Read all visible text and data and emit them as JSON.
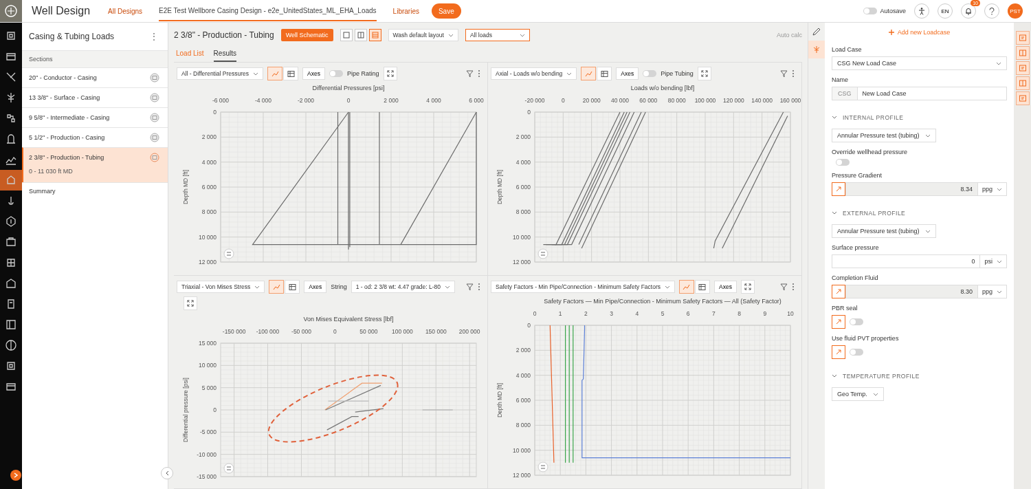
{
  "topbar": {
    "app_title": "Well Design",
    "nav": [
      {
        "label": "All Designs",
        "kind": "link"
      },
      {
        "label": "E2E Test Wellbore Casing Design - e2e_UnitedStates_ML_EHA_Loads",
        "kind": "current"
      },
      {
        "label": "Libraries",
        "kind": "link"
      }
    ],
    "save": "Save",
    "autosave": {
      "label": "Autosave",
      "on": false
    },
    "lang": "EN",
    "notifications": "10",
    "avatar": "PST"
  },
  "rail": [
    {
      "selected": false
    },
    {
      "selected": false
    },
    {
      "selected": false
    },
    {
      "selected": false
    },
    {
      "selected": false
    },
    {
      "selected": false
    },
    {
      "selected": false
    },
    {
      "selected": true
    },
    {
      "selected": false
    },
    {
      "selected": false
    },
    {
      "selected": false
    },
    {
      "selected": false
    },
    {
      "selected": false
    },
    {
      "selected": false
    },
    {
      "selected": false
    },
    {
      "selected": false
    },
    {
      "selected": false
    },
    {
      "selected": false
    }
  ],
  "sidebar": {
    "title": "Casing & Tubing Loads",
    "menu": "⋮",
    "group": "Sections",
    "items": [
      {
        "label": "20\" - Conductor - Casing",
        "kind": "string",
        "selected": false
      },
      {
        "label": "13 3/8\" - Surface - Casing",
        "kind": "string",
        "selected": false
      },
      {
        "label": "9 5/8\" - Intermediate - Casing",
        "kind": "string",
        "selected": false
      },
      {
        "label": "5 1/2\" - Production - Casing",
        "kind": "string",
        "selected": false
      },
      {
        "label": "2 3/8\" - Production - Tubing",
        "detail": "0 - 11 030 ft MD",
        "kind": "string",
        "selected": true
      },
      {
        "label": "Summary",
        "kind": "summary",
        "selected": false
      }
    ]
  },
  "header": {
    "title": "2 3/8\" - Production - Tubing",
    "schematic": "Well Schematic",
    "layouts": [
      {
        "selected": false
      },
      {
        "selected": false
      },
      {
        "selected": true
      }
    ],
    "layout_select": "Wash default layout",
    "loads_select": "All loads",
    "auto_calc": "Auto calc"
  },
  "tabs": [
    {
      "label": "Load List",
      "selected": false
    },
    {
      "label": "Results",
      "selected": true
    }
  ],
  "panels": [
    {
      "toolbar": {
        "selector": "All - Differential Pressures",
        "views": [
          {
            "selected": true
          },
          {
            "selected": false
          }
        ],
        "axes": "Axes",
        "toggle": {
          "label": "Pipe Rating",
          "on": false
        }
      },
      "highlight": false,
      "chart_data": {
        "type": "line",
        "grid": true,
        "xlabel": "Differential Pressures [psi]",
        "ylabel": "Depth MD [ft]",
        "x": [
          0,
          -4500,
          6000,
          6000,
          6000,
          2450,
          -500,
          -500,
          0,
          0,
          60,
          60,
          1450,
          1450
        ],
        "xlim": [
          -6000,
          6000
        ],
        "ylim": [
          12000,
          0
        ],
        "xticks": [
          {
            "value": -6000,
            "label": "-6 000"
          },
          {
            "value": -4000,
            "label": "-4 000"
          },
          {
            "value": -2000,
            "label": "-2 000"
          },
          {
            "value": 0,
            "label": "0"
          },
          {
            "value": 2000,
            "label": "2 000"
          },
          {
            "value": 4000,
            "label": "4 000"
          },
          {
            "value": 6000,
            "label": "6 000"
          }
        ],
        "yticks": [
          {
            "value": 0,
            "label": "0"
          },
          {
            "value": 2000,
            "label": "2 000"
          },
          {
            "value": 4000,
            "label": "4 000"
          },
          {
            "value": 6000,
            "label": "6 000"
          },
          {
            "value": 8000,
            "label": "8 000"
          },
          {
            "value": 10000,
            "label": "10 000"
          },
          {
            "value": 12000,
            "label": "12 000"
          }
        ],
        "series": [
          {
            "color": "#6b6b6b",
            "values": [
              0,
              10600,
              10600,
              0,
              null,
              null,
              null,
              null,
              null,
              null,
              null,
              null,
              null,
              null
            ]
          },
          {
            "color": "#6b6b6b",
            "values": [
              null,
              null,
              null,
              null,
              0,
              10600,
              null,
              null,
              null,
              null,
              null,
              null,
              null,
              null
            ]
          },
          {
            "color": "#6b6b6b",
            "values": [
              null,
              null,
              null,
              null,
              null,
              null,
              0,
              10600,
              null,
              null,
              null,
              null,
              null,
              null
            ]
          },
          {
            "color": "#6b6b6b",
            "values": [
              null,
              null,
              null,
              null,
              null,
              null,
              null,
              null,
              0,
              11000,
              null,
              null,
              null,
              null
            ]
          },
          {
            "color": "#6b6b6b",
            "values": [
              null,
              null,
              null,
              null,
              null,
              null,
              null,
              null,
              null,
              null,
              0,
              10800,
              null,
              null
            ]
          },
          {
            "color": "#6b6b6b",
            "values": [
              null,
              null,
              null,
              null,
              null,
              null,
              null,
              null,
              null,
              null,
              null,
              null,
              0,
              10600
            ]
          }
        ]
      }
    },
    {
      "toolbar": {
        "selector": "Axial - Loads w/o bending",
        "views": [
          {
            "selected": true
          },
          {
            "selected": false
          }
        ],
        "axes": "Axes",
        "toggle": {
          "label": "Pipe Tubing",
          "on": false
        }
      },
      "highlight": false,
      "chart_data": {
        "type": "line",
        "grid": true,
        "xlabel": "Loads w/o bending [lbf]",
        "ylabel": "Depth MD [ft]",
        "x": [
          40000,
          -5000,
          -14000,
          43000,
          -1000,
          -8000,
          45000,
          1000,
          47000,
          3000,
          -6000,
          50000,
          6000,
          -12000,
          55000,
          11000,
          58000,
          13000,
          155000,
          107000,
          106000,
          158000,
          112000
        ],
        "xlim": [
          -20000,
          160000
        ],
        "ylim": [
          12000,
          0
        ],
        "xticks": [
          {
            "value": -20000,
            "label": "-20 000"
          },
          {
            "value": 0,
            "label": "0"
          },
          {
            "value": 20000,
            "label": "20 000"
          },
          {
            "value": 40000,
            "label": "40 000"
          },
          {
            "value": 60000,
            "label": "60 000"
          },
          {
            "value": 80000,
            "label": "80 000"
          },
          {
            "value": 100000,
            "label": "100 000"
          },
          {
            "value": 120000,
            "label": "120 000"
          },
          {
            "value": 140000,
            "label": "140 000"
          },
          {
            "value": 160000,
            "label": "160 000"
          }
        ],
        "yticks": [
          {
            "value": 0,
            "label": "0"
          },
          {
            "value": 2000,
            "label": "2 000"
          },
          {
            "value": 4000,
            "label": "4 000"
          },
          {
            "value": 6000,
            "label": "6 000"
          },
          {
            "value": 8000,
            "label": "8 000"
          },
          {
            "value": 10000,
            "label": "10 000"
          },
          {
            "value": 12000,
            "label": "12 000"
          }
        ],
        "series": [
          {
            "color": "#6b6b6b",
            "values": [
              0,
              10600,
              10600,
              null,
              null,
              null,
              null,
              null,
              null,
              null,
              null,
              null,
              null,
              null,
              null,
              null,
              null,
              null,
              null,
              null,
              null,
              null,
              null
            ]
          },
          {
            "color": "#6b6b6b",
            "values": [
              null,
              null,
              null,
              0,
              10600,
              10600,
              null,
              null,
              null,
              null,
              null,
              null,
              null,
              null,
              null,
              null,
              null,
              null,
              null,
              null,
              null,
              null,
              null
            ]
          },
          {
            "color": "#6b6b6b",
            "values": [
              null,
              null,
              null,
              null,
              null,
              null,
              0,
              10600,
              null,
              null,
              null,
              null,
              null,
              null,
              null,
              null,
              null,
              null,
              null,
              null,
              null,
              null,
              null
            ]
          },
          {
            "color": "#6b6b6b",
            "values": [
              null,
              null,
              null,
              null,
              null,
              null,
              null,
              null,
              0,
              10600,
              10600,
              null,
              null,
              null,
              null,
              null,
              null,
              null,
              null,
              null,
              null,
              null,
              null
            ]
          },
          {
            "color": "#6b6b6b",
            "values": [
              null,
              null,
              null,
              null,
              null,
              null,
              null,
              null,
              null,
              null,
              null,
              0,
              10600,
              10600,
              null,
              null,
              null,
              null,
              null,
              null,
              null,
              null,
              null
            ]
          },
          {
            "color": "#6b6b6b",
            "values": [
              null,
              null,
              null,
              null,
              null,
              null,
              null,
              null,
              null,
              null,
              null,
              null,
              null,
              null,
              0,
              10600,
              null,
              null,
              null,
              null,
              null,
              null,
              null
            ]
          },
          {
            "color": "#6b6b6b",
            "values": [
              null,
              null,
              null,
              null,
              null,
              null,
              null,
              null,
              null,
              null,
              null,
              null,
              null,
              null,
              null,
              null,
              0,
              10900,
              null,
              null,
              null,
              null,
              null
            ]
          },
          {
            "color": "#6b6b6b",
            "values": [
              null,
              null,
              null,
              null,
              null,
              null,
              null,
              null,
              null,
              null,
              null,
              null,
              null,
              null,
              null,
              null,
              null,
              null,
              0,
              10300,
              10900,
              null,
              null
            ]
          },
          {
            "color": "#6b6b6b",
            "values": [
              null,
              null,
              null,
              null,
              null,
              null,
              null,
              null,
              null,
              null,
              null,
              null,
              null,
              null,
              null,
              null,
              null,
              null,
              null,
              null,
              null,
              300,
              10900
            ]
          }
        ]
      }
    },
    {
      "toolbar": {
        "selector": "Triaxial - Von Mises Stress",
        "views": [
          {
            "selected": true
          },
          {
            "selected": false
          }
        ],
        "axes": "Axes",
        "string": {
          "label": "String",
          "value": "1 - od: 2 3/8 wt: 4.47 grade: L-80"
        }
      },
      "highlight": true,
      "chart_data": {
        "type": "line",
        "grid": true,
        "xlabel": "Von Mises Equivalent Stress [lbf]",
        "ylabel": "Differential pressure [psi]",
        "x": [
          -15000,
          40000,
          70000,
          -14000,
          68000,
          30000,
          72000,
          -12000,
          25000,
          35000,
          -10000,
          50000,
          130000,
          175000
        ],
        "xlim": [
          -170000,
          210000
        ],
        "ylim": [
          -15000,
          15000
        ],
        "xticks": [
          {
            "value": -150000,
            "label": "-150 000"
          },
          {
            "value": -100000,
            "label": "-100 000"
          },
          {
            "value": -50000,
            "label": "-50 000"
          },
          {
            "value": 0,
            "label": "0"
          },
          {
            "value": 50000,
            "label": "50 000"
          },
          {
            "value": 100000,
            "label": "100 000"
          },
          {
            "value": 150000,
            "label": "150 000"
          },
          {
            "value": 200000,
            "label": "200 000"
          }
        ],
        "yticks": [
          {
            "value": 15000,
            "label": "15 000"
          },
          {
            "value": 10000,
            "label": "10 000"
          },
          {
            "value": 5000,
            "label": "5 000"
          },
          {
            "value": 0,
            "label": "0"
          },
          {
            "value": -5000,
            "label": "-5 000"
          },
          {
            "value": -10000,
            "label": "-10 000"
          },
          {
            "value": -15000,
            "label": "-15 000"
          }
        ],
        "series": [
          {
            "color": "#f0a070",
            "values": [
              0,
              6000,
              6000,
              null,
              null,
              null,
              null,
              null,
              null,
              null,
              null,
              null,
              null,
              null
            ]
          },
          {
            "color": "#777777",
            "values": [
              null,
              null,
              null,
              0,
              5500,
              null,
              null,
              null,
              null,
              null,
              null,
              null,
              null,
              null
            ]
          },
          {
            "color": "#777777",
            "values": [
              null,
              null,
              null,
              null,
              null,
              -500,
              300,
              null,
              null,
              null,
              null,
              null,
              null,
              null
            ]
          },
          {
            "color": "#777777",
            "values": [
              null,
              null,
              null,
              null,
              null,
              null,
              null,
              -4500,
              -1500,
              -1500,
              null,
              null,
              null,
              null
            ]
          },
          {
            "color": "#bbbbbb",
            "values": [
              null,
              null,
              null,
              null,
              null,
              null,
              null,
              null,
              null,
              null,
              2000,
              2000,
              null,
              null
            ]
          },
          {
            "color": "#aaaaaa",
            "values": [
              null,
              null,
              null,
              null,
              null,
              null,
              null,
              null,
              null,
              null,
              null,
              null,
              0,
              0
            ]
          }
        ]
      }
    },
    {
      "toolbar": {
        "selector": "Safety Factors - Min Pipe/Connection - Minimum Safety Factors",
        "views": [
          {
            "selected": true
          },
          {
            "selected": false
          }
        ],
        "axes": "Axes"
      },
      "highlight": false,
      "chart_data": {
        "type": "line",
        "grid": true,
        "xlabel": "Safety Factors — Min Pipe/Connection - Minimum Safety Factors — All (Safety Factor)",
        "ylabel": "Depth MD [ft]",
        "x": [
          0.6,
          0.75,
          1.2,
          1.2,
          1.35,
          1.35,
          1.5,
          1.5,
          1.95,
          1.95,
          1.9,
          1.85,
          1.85,
          10
        ],
        "xlim": [
          0,
          10
        ],
        "ylim": [
          12000,
          0
        ],
        "xticks": [
          0,
          1,
          2,
          3,
          4,
          5,
          6,
          7,
          8,
          9,
          10
        ],
        "yticks": [
          {
            "value": 0,
            "label": "0"
          },
          {
            "value": 2000,
            "label": "2 000"
          },
          {
            "value": 4000,
            "label": "4 000"
          },
          {
            "value": 6000,
            "label": "6 000"
          },
          {
            "value": 8000,
            "label": "8 000"
          },
          {
            "value": 10000,
            "label": "10 000"
          },
          {
            "value": 12000,
            "label": "12 000"
          }
        ],
        "series": [
          {
            "color": "#e8602a",
            "values": [
              0,
              11000,
              null,
              null,
              null,
              null,
              null,
              null,
              null,
              null,
              null,
              null,
              null,
              null
            ]
          },
          {
            "color": "#3aa54a",
            "values": [
              null,
              null,
              0,
              11000,
              null,
              null,
              null,
              null,
              null,
              null,
              null,
              null,
              null,
              null
            ]
          },
          {
            "color": "#3aa54a",
            "values": [
              null,
              null,
              null,
              null,
              0,
              11000,
              null,
              null,
              null,
              null,
              null,
              null,
              null,
              null
            ]
          },
          {
            "color": "#3aa54a",
            "values": [
              null,
              null,
              null,
              null,
              null,
              null,
              0,
              11000,
              null,
              null,
              null,
              null,
              null,
              null
            ]
          },
          {
            "color": "#5b7fd6",
            "values": [
              null,
              null,
              null,
              null,
              null,
              null,
              null,
              null,
              0,
              300,
              4300,
              4400,
              10600,
              10600
            ]
          }
        ]
      }
    }
  ],
  "editor_tools": [
    {
      "selected": false
    },
    {
      "selected": true
    }
  ],
  "editor": {
    "add": "Add new Loadcase",
    "fields": [
      {
        "kind": "select",
        "label": "Load Case",
        "value": "CSG New Load Case"
      },
      {
        "kind": "prefixed",
        "label": "Name",
        "prefix": "CSG",
        "value": "New Load Case"
      },
      {
        "kind": "section",
        "label": "INTERNAL PROFILE",
        "expanded": true
      },
      {
        "kind": "dropdown",
        "value": "Annular Pressure test (tubing)"
      },
      {
        "kind": "toggle",
        "label": "Override wellhead pressure",
        "linked": false,
        "on": false
      },
      {
        "kind": "number",
        "label": "Pressure Gradient",
        "linked": true,
        "value": "8.34",
        "unit": "ppg"
      },
      {
        "kind": "section",
        "label": "EXTERNAL PROFILE",
        "expanded": true
      },
      {
        "kind": "dropdown",
        "value": "Annular Pressure test (tubing)"
      },
      {
        "kind": "number",
        "label": "Surface pressure",
        "linked": false,
        "value": "0",
        "unit": "psi"
      },
      {
        "kind": "number",
        "label": "Completion Fluid",
        "linked": true,
        "value": "8.30",
        "unit": "ppg"
      },
      {
        "kind": "toggle",
        "label": "PBR seal",
        "linked": true,
        "on": false
      },
      {
        "kind": "toggle",
        "label": "Use fluid PVT properties",
        "linked": true,
        "on": false
      },
      {
        "kind": "section",
        "label": "TEMPERATURE PROFILE",
        "expanded": true
      },
      {
        "kind": "dropdown",
        "value": "Geo Temp."
      }
    ]
  }
}
